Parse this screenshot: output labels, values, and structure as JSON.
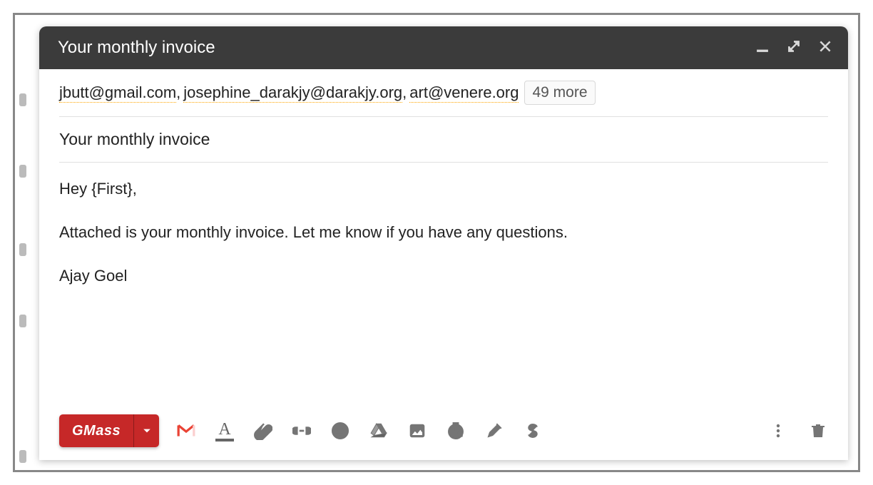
{
  "header": {
    "title": "Your monthly invoice"
  },
  "recipients": {
    "emails": [
      "jbutt@gmail.com",
      "josephine_darakjy@darakjy.org",
      "art@venere.org"
    ],
    "more_label": "49 more"
  },
  "subject": "Your monthly invoice",
  "body": {
    "line1": "Hey {First},",
    "line2": "Attached is your monthly invoice. Let me know if you have any questions.",
    "line3": "Ajay Goel"
  },
  "toolbar": {
    "send_label": "GMass",
    "icons": {
      "gmail": "gmail-icon",
      "format": "format-text-icon",
      "attach": "paperclip-icon",
      "link": "link-icon",
      "emoji": "emoji-icon",
      "drive": "drive-icon",
      "photo": "photo-icon",
      "snooze": "clock-lock-icon",
      "sign": "pen-icon",
      "money": "dollar-icon",
      "more": "more-vert-icon",
      "trash": "trash-icon"
    }
  },
  "colors": {
    "header_bg": "#3b3b3b",
    "gmass_red": "#c62828",
    "icon_gray": "#757575"
  }
}
